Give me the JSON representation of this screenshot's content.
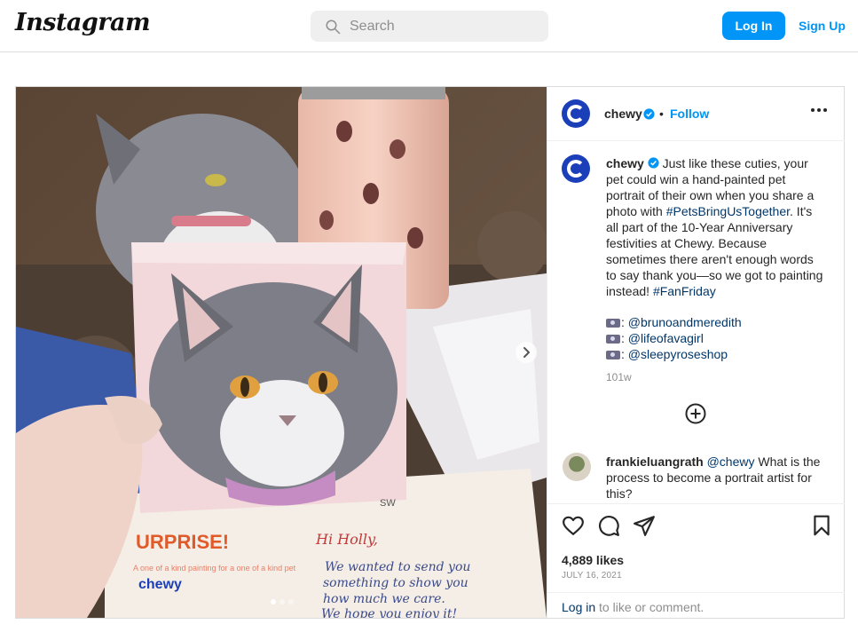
{
  "header": {
    "logo": "Instagram",
    "search_placeholder": "Search",
    "login_label": "Log In",
    "signup_label": "Sign Up",
    "accent_color": "#0095f6"
  },
  "post": {
    "author": "chewy",
    "follow_label": "Follow",
    "separator": "•",
    "caption_user": "chewy",
    "caption_parts": [
      "Just like these cuties, your pet could win a hand-painted pet portrait of their own when you share a photo with ",
      "#PetsBringUsTogether",
      ". It's all part of the 10-Year Anniversary festivities at Chewy. Because sometimes there aren't enough words to say thank you—so we got to painting instead! ",
      "#FanFriday"
    ],
    "credits": [
      "@brunoandmeredith",
      "@lifeofavagirl",
      "@sleepyroseshop"
    ],
    "credit_prefix": ":",
    "caption_age": "101w",
    "comment": {
      "user": "frankieluangrath",
      "mention": "@chewy",
      "text": "What is the process to become a portrait artist for this?"
    },
    "likes": "4,889 likes",
    "date": "JULY 16, 2021",
    "login_prompt_link": "Log in",
    "login_prompt_text": "to like or comment."
  },
  "media": {
    "carousel_count": 3,
    "active_index": 0,
    "card_text": {
      "headline": "URPRISE!",
      "sub": "A one of a kind painting for a one of a kind pet",
      "brand": "chewy",
      "note_greeting": "Hi Holly,",
      "note_lines": [
        "We wanted to send you",
        "something to show you",
        "how much we care.",
        "We hope you enjoy it!"
      ],
      "signature": "SW"
    }
  },
  "icons": {
    "search": "search-icon",
    "verified": "verified-badge-icon",
    "more": "more-options-icon",
    "next": "chevron-right-icon",
    "plus": "load-more-comments-icon",
    "like": "heart-icon",
    "comment": "comment-icon",
    "share": "share-icon",
    "save": "bookmark-icon"
  }
}
